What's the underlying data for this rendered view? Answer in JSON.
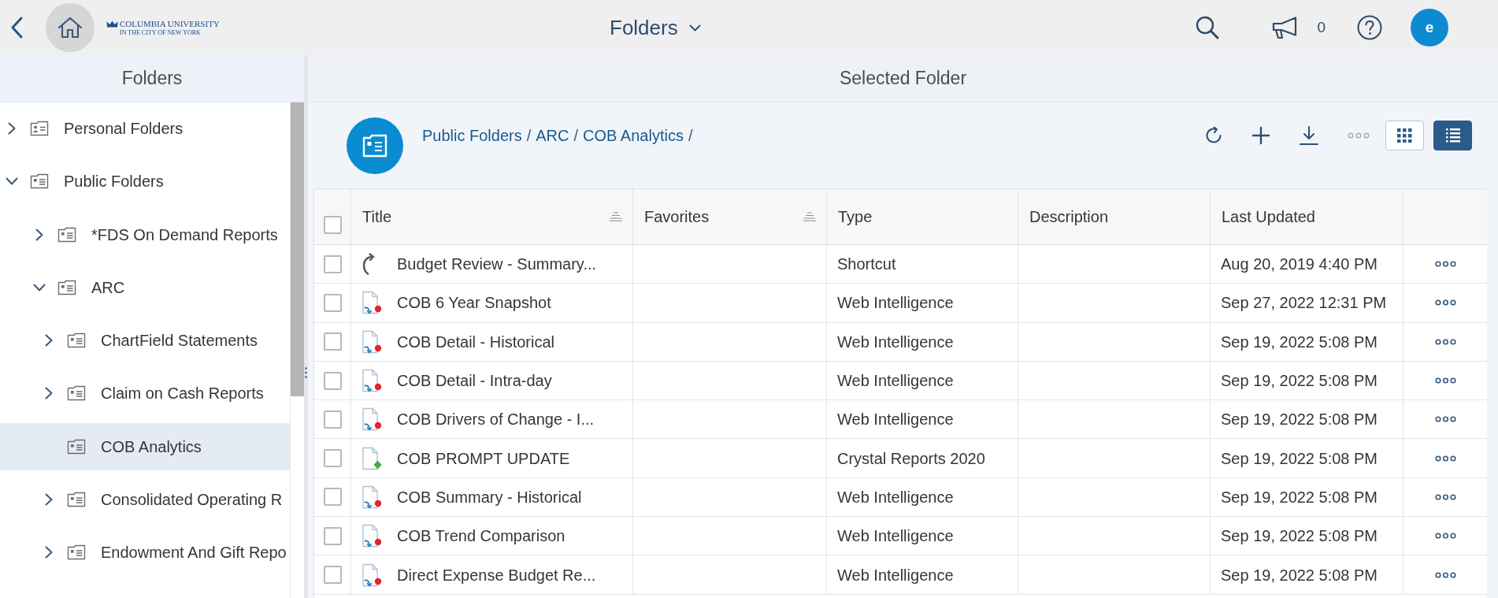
{
  "header": {
    "logo": {
      "name": "COLUMBIA UNIVERSITY",
      "tagline": "IN THE CITY OF NEW YORK"
    },
    "title": "Folders",
    "notification_count": "0",
    "avatar_initial": "e"
  },
  "sidebar": {
    "title": "Folders",
    "tree": [
      {
        "label": "Personal Folders",
        "kind": "personal",
        "expanded": false,
        "selected": false
      },
      {
        "label": "Public Folders",
        "kind": "folder",
        "expanded": true,
        "selected": false,
        "children": [
          {
            "label": "*FDS On Demand Reports",
            "kind": "folder",
            "expanded": false,
            "selected": false
          },
          {
            "label": "ARC",
            "kind": "folder",
            "expanded": true,
            "selected": false,
            "children": [
              {
                "label": "ChartField Statements",
                "kind": "folder",
                "expanded": false,
                "selected": false
              },
              {
                "label": "Claim on Cash Reports",
                "kind": "folder",
                "expanded": false,
                "selected": false
              },
              {
                "label": "COB Analytics",
                "kind": "folder",
                "selected": true
              },
              {
                "label": "Consolidated Operating R",
                "kind": "folder",
                "expanded": false,
                "selected": false
              },
              {
                "label": "Endowment And Gift Repo",
                "kind": "folder",
                "expanded": false,
                "selected": false
              }
            ]
          }
        ]
      }
    ]
  },
  "content": {
    "title": "Selected Folder",
    "breadcrumb": {
      "items": [
        "Public Folders",
        "ARC",
        "COB Analytics"
      ],
      "separator": "/"
    },
    "toolbar": [
      {
        "kind": "refresh",
        "disabled": false
      },
      {
        "kind": "add",
        "disabled": false
      },
      {
        "kind": "download",
        "disabled": false
      },
      {
        "kind": "more",
        "disabled": true
      }
    ],
    "view_buttons": [
      {
        "kind": "grid",
        "selected": false
      },
      {
        "kind": "list",
        "selected": true
      }
    ],
    "table": {
      "select_all_checked": false,
      "columns": [
        {
          "label": "Title",
          "sortable": true
        },
        {
          "label": "Favorites",
          "sortable": true
        },
        {
          "label": "Type",
          "sortable": false
        },
        {
          "label": "Description",
          "sortable": false
        },
        {
          "label": "Last Updated",
          "sortable": false
        }
      ],
      "rows": [
        {
          "kind": "shortcut",
          "checked": false,
          "title": "Budget Review - Summary...",
          "type": "Shortcut",
          "last_updated": "Aug 20, 2019 4:40 PM"
        },
        {
          "kind": "webi",
          "checked": false,
          "title": "COB 6 Year Snapshot",
          "type": "Web Intelligence",
          "last_updated": "Sep 27, 2022 12:31 PM"
        },
        {
          "kind": "webi",
          "checked": false,
          "title": "COB Detail - Historical",
          "type": "Web Intelligence",
          "last_updated": "Sep 19, 2022 5:08 PM"
        },
        {
          "kind": "webi",
          "checked": false,
          "title": "COB Detail - Intra-day",
          "type": "Web Intelligence",
          "last_updated": "Sep 19, 2022 5:08 PM"
        },
        {
          "kind": "webi",
          "checked": false,
          "title": "COB Drivers of Change - I...",
          "type": "Web Intelligence",
          "last_updated": "Sep 19, 2022 5:08 PM"
        },
        {
          "kind": "crystal",
          "checked": false,
          "title": "COB PROMPT UPDATE",
          "type": "Crystal Reports 2020",
          "last_updated": "Sep 19, 2022 5:08 PM"
        },
        {
          "kind": "webi",
          "checked": false,
          "title": "COB Summary - Historical",
          "type": "Web Intelligence",
          "last_updated": "Sep 19, 2022 5:08 PM"
        },
        {
          "kind": "webi",
          "checked": false,
          "title": "COB Trend Comparison",
          "type": "Web Intelligence",
          "last_updated": "Sep 19, 2022 5:08 PM"
        },
        {
          "kind": "webi",
          "checked": false,
          "title": "Direct Expense Budget Re...",
          "type": "Web Intelligence",
          "last_updated": "Sep 19, 2022 5:08 PM"
        }
      ]
    }
  }
}
